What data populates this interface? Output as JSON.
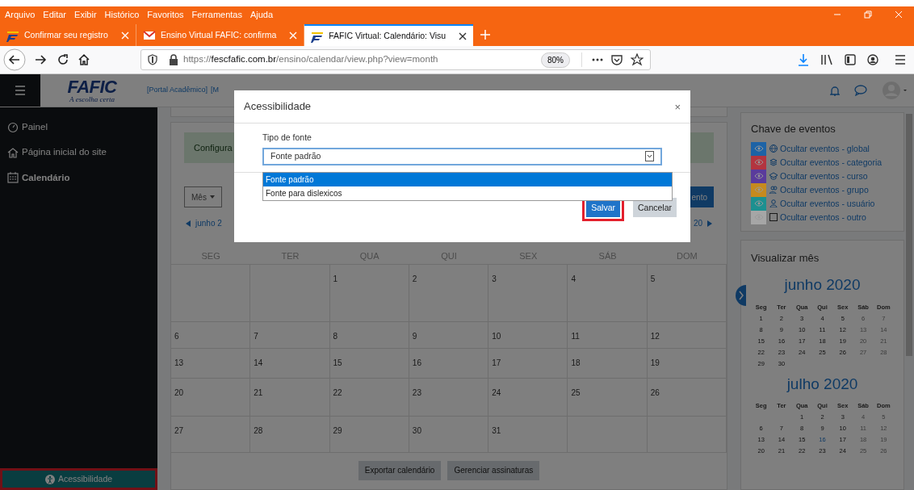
{
  "browser": {
    "menu": [
      "Arquivo",
      "Editar",
      "Exibir",
      "Histórico",
      "Favoritos",
      "Ferramentas",
      "Ajuda"
    ],
    "tabs": [
      {
        "title": "Confirmar seu registro",
        "kind": "logo",
        "selected": false
      },
      {
        "title": "Ensino Virtual FAFIC: confirma",
        "kind": "mail",
        "selected": false
      },
      {
        "title": "FAFIC Virtual: Calendário: Visu",
        "kind": "logo",
        "selected": true
      }
    ],
    "url": {
      "scheme": "https://",
      "domain": "fescfafic.com.br",
      "path": "/ensino/calendar/view.php?view=month"
    },
    "zoom": "80%"
  },
  "header": {
    "logo": {
      "name": "FAFIC",
      "slogan": "A escolha certa"
    },
    "links": [
      "[Portal Acadêmico]",
      "[M"
    ]
  },
  "sidebar": {
    "items": [
      {
        "label": "Painel",
        "kind": "gauge",
        "selected": false
      },
      {
        "label": "Página inicial do site",
        "kind": "home",
        "selected": false
      },
      {
        "label": "Calendário",
        "kind": "calendar",
        "selected": true
      }
    ],
    "accessibility_button": {
      "label": "Acessibilidade",
      "highlighted": true
    }
  },
  "main": {
    "notice": "Configura",
    "view_select": "Mês",
    "new_event": "ento",
    "prev_month": "junho 2",
    "next_month": "20",
    "weekdays": [
      "SEG",
      "TER",
      "QUA",
      "QUI",
      "SEX",
      "SÁB",
      "DOM"
    ],
    "weeks": [
      [
        "1",
        "2",
        "3",
        "4",
        "5"
      ],
      [
        "6",
        "7",
        "8",
        "9",
        "10",
        "11",
        "12"
      ],
      [
        "13",
        "14",
        "15",
        "16",
        "17",
        "18",
        "19"
      ],
      [
        "20",
        "21",
        "22",
        "23",
        "24",
        "25",
        "26"
      ],
      [
        "27",
        "28",
        "29",
        "30",
        "31"
      ]
    ],
    "buttons": [
      "Exportar calendário",
      "Gerenciar assinaturas"
    ]
  },
  "events_key": {
    "title": "Chave de eventos",
    "items": [
      {
        "label": "Ocultar eventos - global",
        "kind": "globe",
        "color": "#1d63a6"
      },
      {
        "label": "Ocultar eventos - categoria",
        "kind": "layers",
        "color": "#b3353f"
      },
      {
        "label": "Ocultar eventos - curso",
        "kind": "cap",
        "color": "#5a3b9c"
      },
      {
        "label": "Ocultar eventos - grupo",
        "kind": "group",
        "color": "#c68a1e"
      },
      {
        "label": "Ocultar eventos - usuário",
        "kind": "user",
        "color": "#1c9090"
      },
      {
        "label": "Ocultar eventos - outro",
        "kind": "square",
        "color": "#a6a6a6"
      }
    ]
  },
  "month_view": {
    "title": "Visualizar mês",
    "months": [
      {
        "title": "junho 2020",
        "weekdays": [
          "Seg",
          "Ter",
          "Qua",
          "Qui",
          "Sex",
          "Sáb",
          "Dom"
        ],
        "weeks": [
          [
            "1",
            "2",
            "3",
            "4",
            "5",
            "6",
            "7"
          ],
          [
            "8",
            "9",
            "10",
            "11",
            "12",
            "13",
            "14"
          ],
          [
            "15",
            "16",
            "17",
            "18",
            "19",
            "20",
            "21"
          ],
          [
            "22",
            "23",
            "24",
            "25",
            "26",
            "27",
            "28"
          ],
          [
            "29",
            "30"
          ]
        ]
      },
      {
        "title": "julho 2020",
        "weekdays": [
          "Seg",
          "Ter",
          "Qua",
          "Qui",
          "Sex",
          "Sáb",
          "Dom"
        ],
        "weeks": [
          [
            "1",
            "2",
            "3",
            "4",
            "5"
          ],
          [
            "6",
            "7",
            "8",
            "9",
            "10",
            "11",
            "12"
          ],
          [
            "13",
            "14",
            "15",
            {
              "day": "16",
              "today": true
            },
            "17",
            "18",
            "19"
          ],
          [
            "20",
            "21",
            "22",
            "23",
            "24",
            "25",
            "26"
          ]
        ]
      }
    ]
  },
  "modal": {
    "title": "Acessibilidade",
    "close": "×",
    "field_label": "Tipo de fonte",
    "value": "Fonte padrão",
    "options": [
      {
        "label": "Fonte padrão",
        "selected": true
      },
      {
        "label": "Fonte para dislexicos",
        "selected": false
      }
    ],
    "buttons": [
      {
        "label": "Salvar",
        "kind": "primary",
        "highlighted": true
      },
      {
        "label": "Cancelar",
        "kind": "secondary",
        "highlighted": false
      }
    ]
  }
}
